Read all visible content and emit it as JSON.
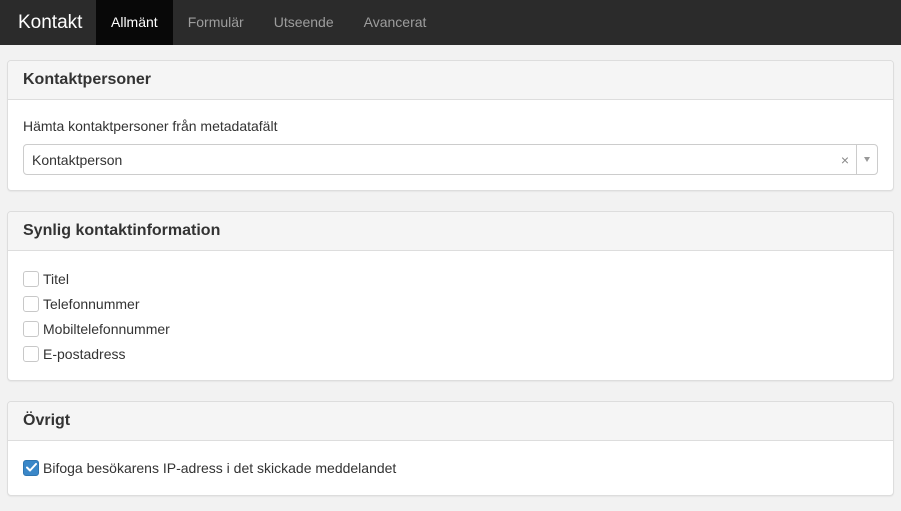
{
  "header": {
    "brand": "Kontakt",
    "tabs": [
      {
        "label": "Allmänt",
        "active": true
      },
      {
        "label": "Formulär",
        "active": false
      },
      {
        "label": "Utseende",
        "active": false
      },
      {
        "label": "Avancerat",
        "active": false
      }
    ]
  },
  "contacts_panel": {
    "title": "Kontaktpersoner",
    "field_label": "Hämta kontaktpersoner från metadatafält",
    "select_value": "Kontaktperson",
    "clear_icon": "×"
  },
  "visible_info_panel": {
    "title": "Synlig kontaktinformation",
    "options": [
      {
        "label": "Titel",
        "checked": false
      },
      {
        "label": "Telefonnummer",
        "checked": false
      },
      {
        "label": "Mobiltelefonnummer",
        "checked": false
      },
      {
        "label": "E-postadress",
        "checked": false
      }
    ]
  },
  "other_panel": {
    "title": "Övrigt",
    "options": [
      {
        "label": "Bifoga besökarens IP-adress i det skickade meddelandet",
        "checked": true
      }
    ]
  },
  "colors": {
    "topbar": "#2b2b2b",
    "active_tab": "#080808",
    "checkbox_checked": "#3a87c8"
  }
}
